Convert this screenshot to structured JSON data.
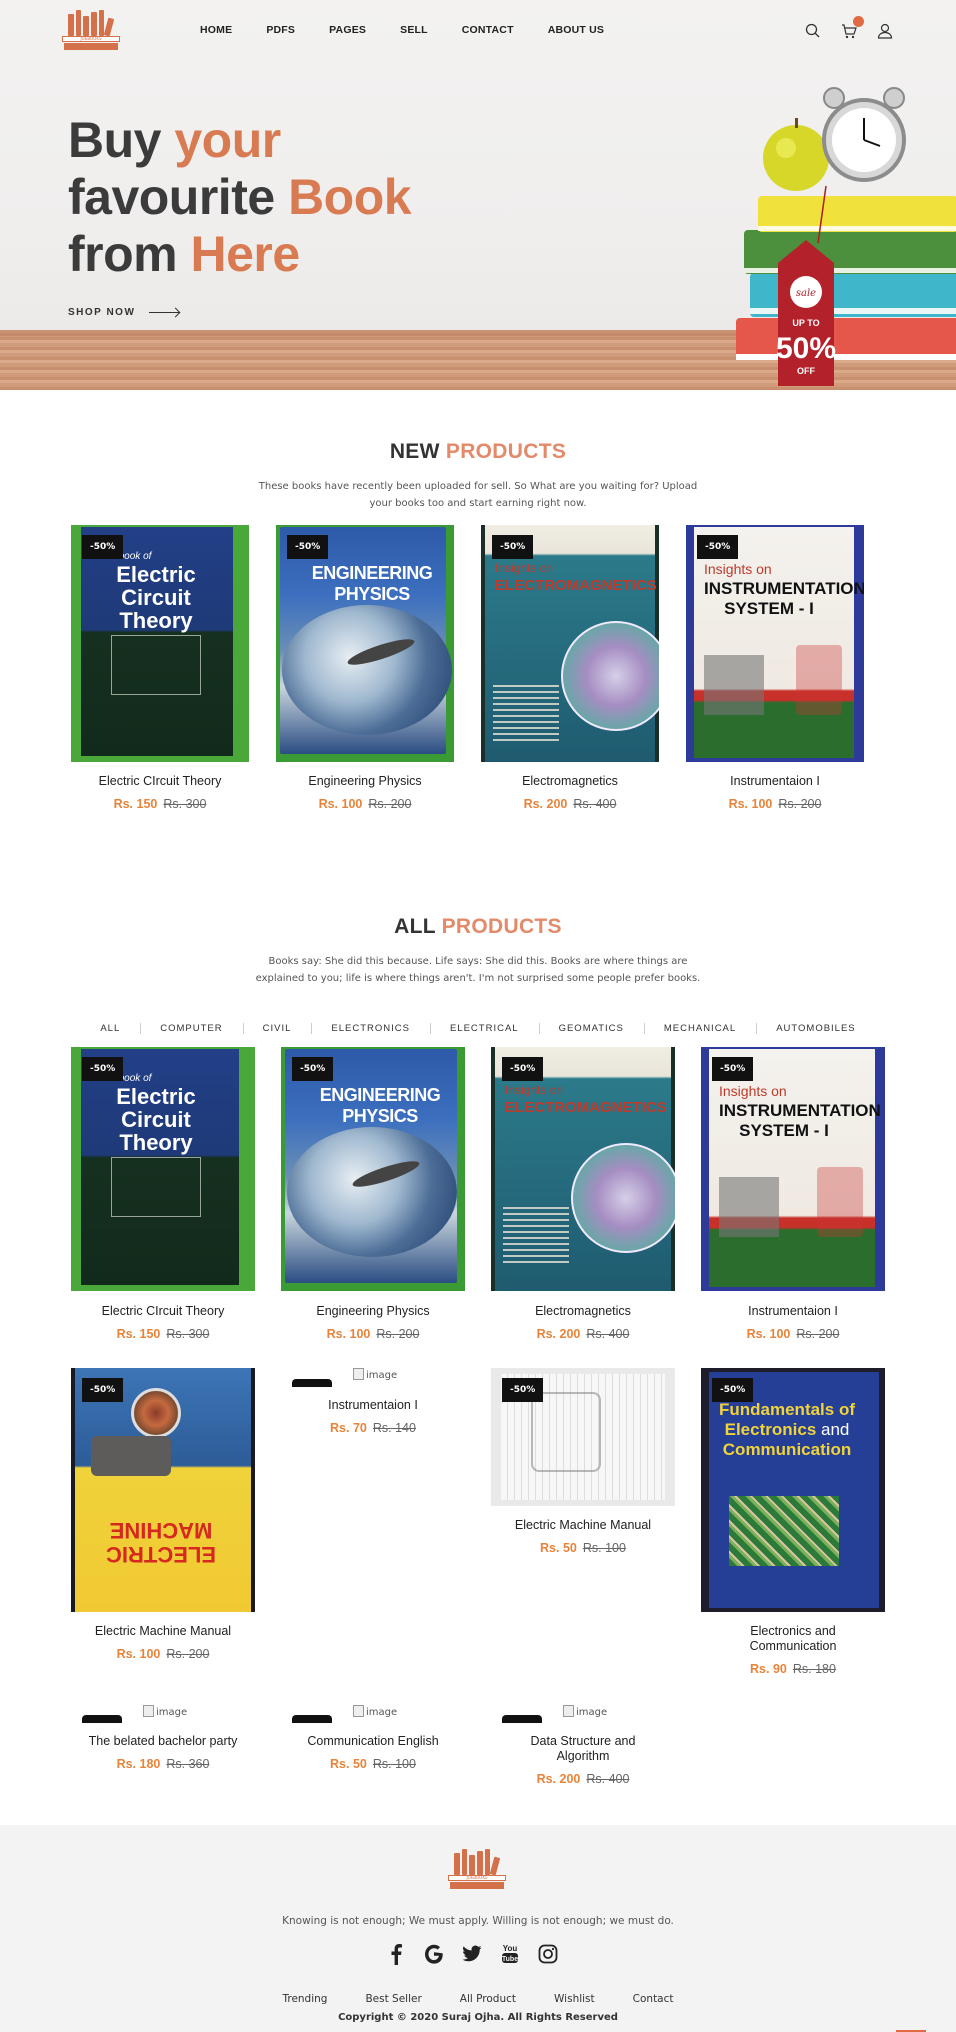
{
  "nav": {
    "logo_text": "JOEBOOKS",
    "menu": [
      "HOME",
      "PDFS",
      "PAGES",
      "SELL",
      "CONTACT",
      "ABOUT US"
    ],
    "icons": [
      "search-icon",
      "cart-icon",
      "user-icon"
    ]
  },
  "hero": {
    "line1_a": "Buy",
    "line1_b": "your",
    "line2_a": "favourite",
    "line2_b": "Book",
    "line3_a": "from",
    "line3_b": "Here",
    "cta": "SHOP NOW",
    "tag_top": "sale",
    "tag_up_to": "UP TO",
    "tag_percent": "50%",
    "tag_off": "OFF"
  },
  "new_products": {
    "title_a": "NEW",
    "title_b": "PRODUCTS",
    "description": "These books have recently been uploaded for sell. So What are you waiting for? Upload your books too and start earning right now.",
    "items": [
      {
        "badge": "-50%",
        "name": "Electric CIrcuit Theory",
        "price": "Rs. 150",
        "old_price": "Rs. 300"
      },
      {
        "badge": "-50%",
        "name": "Engineering Physics",
        "price": "Rs. 100",
        "old_price": "Rs. 200"
      },
      {
        "badge": "-50%",
        "name": "Electromagnetics",
        "price": "Rs. 200",
        "old_price": "Rs. 400"
      },
      {
        "badge": "-50%",
        "name": "Instrumentaion I",
        "price": "Rs. 100",
        "old_price": "Rs. 200"
      }
    ]
  },
  "all_products": {
    "title_a": "ALL",
    "title_b": "PRODUCTS",
    "description": "Books say: She did this because. Life says: She did this. Books are where things are explained to you; life is where things aren't. I'm not surprised some people prefer books.",
    "filters": [
      "ALL",
      "COMPUTER",
      "CIVIL",
      "ELECTRONICS",
      "ELECTRICAL",
      "GEOMATICS",
      "MECHANICAL",
      "AUTOMOBILES"
    ],
    "items": [
      {
        "badge": "-50%",
        "name": "Electric CIrcuit Theory",
        "price": "Rs. 150",
        "old_price": "Rs. 300"
      },
      {
        "badge": "-50%",
        "name": "Engineering Physics",
        "price": "Rs. 100",
        "old_price": "Rs. 200"
      },
      {
        "badge": "-50%",
        "name": "Electromagnetics",
        "price": "Rs. 200",
        "old_price": "Rs. 400"
      },
      {
        "badge": "-50%",
        "name": "Instrumentaion I",
        "price": "Rs. 100",
        "old_price": "Rs. 200"
      },
      {
        "badge": "-50%",
        "name": "Electric Machine Manual",
        "price": "Rs. 100",
        "old_price": "Rs. 200"
      },
      {
        "image_alt": "image",
        "name": "Instrumentaion I",
        "price": "Rs. 70",
        "old_price": "Rs. 140"
      },
      {
        "badge": "-50%",
        "name": "Electric Machine Manual",
        "price": "Rs. 50",
        "old_price": "Rs. 100"
      },
      {
        "badge": "-50%",
        "name": "Electronics and Communication",
        "price": "Rs. 90",
        "old_price": "Rs. 180"
      },
      {
        "image_alt": "image",
        "name": "The belated bachelor party",
        "price": "Rs. 180",
        "old_price": "Rs. 360"
      },
      {
        "image_alt": "image",
        "name": "Communication English",
        "price": "Rs. 50",
        "old_price": "Rs. 100"
      },
      {
        "image_alt": "image",
        "name": "Data Structure and Algorithm",
        "price": "Rs. 200",
        "old_price": "Rs. 400"
      }
    ]
  },
  "covers": {
    "ect_1": "A Textbook of",
    "ect_2": "Electric Circuit Theory",
    "ep": "ENGINEERING PHYSICS",
    "em_1": "Insights on",
    "em_2": "ELECTROMAGNETICS",
    "ins_1": "Insights on",
    "ins_2": "INSTRUMENTATION SYSTEM - I",
    "emm": "ELECTRIC MACHINE",
    "ec_1": "Fundamentals of",
    "ec_2": "Electronics",
    "ec_3": "and",
    "ec_4": "Communication"
  },
  "footer": {
    "logo_text": "JOEBOOKS",
    "tagline": "Knowing is not enough; We must apply. Willing is not enough; we must do.",
    "social": [
      "facebook-icon",
      "google-icon",
      "twitter-icon",
      "youtube-icon",
      "instagram-icon"
    ],
    "links": [
      "Trending",
      "Best Seller",
      "All Product",
      "Wishlist",
      "Contact"
    ],
    "copyright": "Copyright © 2020 Suraj Ojha. All Rights Reserved"
  },
  "colors": {
    "accent": "#d97b52",
    "price": "#e8833a",
    "badge_bg": "#111111"
  }
}
